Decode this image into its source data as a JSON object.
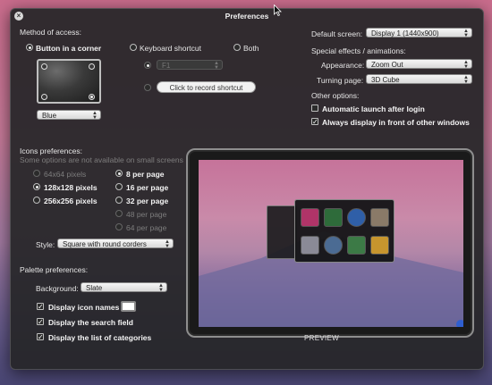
{
  "window": {
    "title": "Preferences"
  },
  "access": {
    "heading": "Method of access:",
    "button_in_corner": "Button in a corner",
    "keyboard_shortcut": "Keyboard shortcut",
    "both": "Both",
    "color_select": "Blue",
    "shortcut_key": "F1",
    "record_button": "Click to record shortcut"
  },
  "display": {
    "default_screen_label": "Default screen:",
    "default_screen_value": "Display 1 (1440x900)",
    "effects_heading": "Special effects / animations:",
    "appearance_label": "Appearance:",
    "appearance_value": "Zoom Out",
    "turning_label": "Turning page:",
    "turning_value": "3D Cube",
    "other_heading": "Other options:",
    "auto_launch": "Automatic launch after login",
    "always_front": "Always display in front of other windows"
  },
  "icons": {
    "heading": "Icons preferences:",
    "note": "Some options are not available on small screens",
    "sizes": [
      "64x64 pixels",
      "128x128 pixels",
      "256x256 pixels"
    ],
    "per_page": [
      "8 per page",
      "16 per page",
      "32 per page",
      "48 per page",
      "64 per page"
    ],
    "style_label": "Style:",
    "style_value": "Square with round corders"
  },
  "palette": {
    "heading": "Palette preferences:",
    "background_label": "Background:",
    "background_value": "Slate",
    "icon_names": "Display icon names",
    "search_field": "Display the search field",
    "categories": "Display the list of categories"
  },
  "preview": {
    "label": "PREVIEW"
  },
  "colors": {
    "panel": "#262628",
    "accent": "#ffffff"
  }
}
